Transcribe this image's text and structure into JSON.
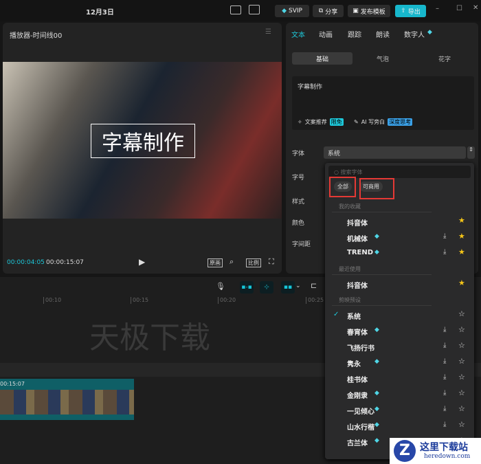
{
  "topbar": {
    "title": "12月3日",
    "svip": "SVIP",
    "share": "分享",
    "publish": "发布模板",
    "export": "导出"
  },
  "player": {
    "title": "播放器-时间线00",
    "subtitle": "字幕制作",
    "current_time": "00:00:04:05",
    "total_time": "00:00:15:07",
    "original_label": "原画",
    "ratio_label": "比例"
  },
  "inspector": {
    "tabs": [
      "文本",
      "动画",
      "跟踪",
      "朗读",
      "数字人"
    ],
    "active_tab": "文本",
    "subtabs": [
      "基础",
      "气泡",
      "花字"
    ],
    "text_value": "字幕制作",
    "copy_suggest": "文案推荐",
    "copy_badge": "限免",
    "ai_write": "AI 写旁白",
    "ai_badge": "深度思考",
    "labels": {
      "font": "字体",
      "size": "字号",
      "style": "样式",
      "color": "颜色",
      "spacing": "字间距"
    },
    "font_value": "系统"
  },
  "font_dropdown": {
    "search_placeholder": "搜索字体",
    "filters": [
      "全部",
      "可商用"
    ],
    "sections": [
      {
        "title": "我的收藏",
        "items": [
          {
            "name": "抖音体",
            "vip": false,
            "download": false,
            "fav": true
          },
          {
            "name": "机械体",
            "vip": true,
            "download": true,
            "fav": true
          },
          {
            "name": "TREND",
            "vip": true,
            "download": true,
            "fav": true
          }
        ]
      },
      {
        "title": "最近使用",
        "items": [
          {
            "name": "抖音体",
            "vip": false,
            "download": false,
            "fav": true
          }
        ]
      },
      {
        "title": "剪映预设",
        "items": [
          {
            "name": "系统",
            "vip": false,
            "download": false,
            "fav": false,
            "selected": true
          },
          {
            "name": "春宵体",
            "vip": true,
            "download": true,
            "fav": false
          },
          {
            "name": "飞扬行书",
            "vip": false,
            "download": true,
            "fav": false
          },
          {
            "name": "隽永",
            "vip": true,
            "download": true,
            "fav": false
          },
          {
            "name": "桂书体",
            "vip": false,
            "download": true,
            "fav": false
          },
          {
            "name": "金刚隶",
            "vip": true,
            "download": true,
            "fav": false
          },
          {
            "name": "一见倾心",
            "vip": true,
            "download": true,
            "fav": false
          },
          {
            "name": "山水行楷",
            "vip": true,
            "download": true,
            "fav": false
          },
          {
            "name": "古兰体",
            "vip": true,
            "download": false,
            "fav": false
          }
        ]
      }
    ]
  },
  "timeline": {
    "ticks": [
      "00:10",
      "00:15",
      "00:20",
      "00:25"
    ],
    "clip_duration": "00:15:07",
    "watermark": "天极下载"
  },
  "watermark_logo": {
    "cn": "这里下载站",
    "url": "heredown.com"
  },
  "colors": {
    "accent": "#1ec8da",
    "highlight_box": "#e53935",
    "star": "#f5c518"
  }
}
